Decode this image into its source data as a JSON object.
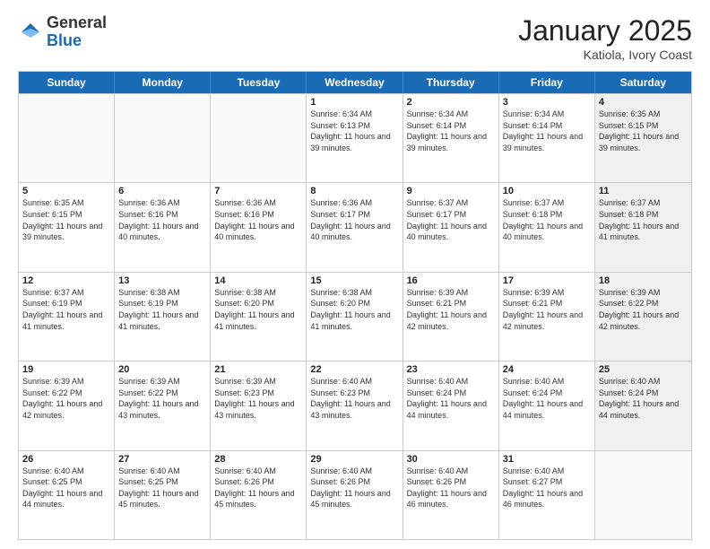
{
  "header": {
    "logo_general": "General",
    "logo_blue": "Blue",
    "month_title": "January 2025",
    "subtitle": "Katiola, Ivory Coast"
  },
  "days_of_week": [
    "Sunday",
    "Monday",
    "Tuesday",
    "Wednesday",
    "Thursday",
    "Friday",
    "Saturday"
  ],
  "weeks": [
    [
      {
        "day": "",
        "info": "",
        "empty": true
      },
      {
        "day": "",
        "info": "",
        "empty": true
      },
      {
        "day": "",
        "info": "",
        "empty": true
      },
      {
        "day": "1",
        "info": "Sunrise: 6:34 AM\nSunset: 6:13 PM\nDaylight: 11 hours and 39 minutes."
      },
      {
        "day": "2",
        "info": "Sunrise: 6:34 AM\nSunset: 6:14 PM\nDaylight: 11 hours and 39 minutes."
      },
      {
        "day": "3",
        "info": "Sunrise: 6:34 AM\nSunset: 6:14 PM\nDaylight: 11 hours and 39 minutes."
      },
      {
        "day": "4",
        "info": "Sunrise: 6:35 AM\nSunset: 6:15 PM\nDaylight: 11 hours and 39 minutes.",
        "shaded": true
      }
    ],
    [
      {
        "day": "5",
        "info": "Sunrise: 6:35 AM\nSunset: 6:15 PM\nDaylight: 11 hours and 39 minutes."
      },
      {
        "day": "6",
        "info": "Sunrise: 6:36 AM\nSunset: 6:16 PM\nDaylight: 11 hours and 40 minutes."
      },
      {
        "day": "7",
        "info": "Sunrise: 6:36 AM\nSunset: 6:16 PM\nDaylight: 11 hours and 40 minutes."
      },
      {
        "day": "8",
        "info": "Sunrise: 6:36 AM\nSunset: 6:17 PM\nDaylight: 11 hours and 40 minutes."
      },
      {
        "day": "9",
        "info": "Sunrise: 6:37 AM\nSunset: 6:17 PM\nDaylight: 11 hours and 40 minutes."
      },
      {
        "day": "10",
        "info": "Sunrise: 6:37 AM\nSunset: 6:18 PM\nDaylight: 11 hours and 40 minutes."
      },
      {
        "day": "11",
        "info": "Sunrise: 6:37 AM\nSunset: 6:18 PM\nDaylight: 11 hours and 41 minutes.",
        "shaded": true
      }
    ],
    [
      {
        "day": "12",
        "info": "Sunrise: 6:37 AM\nSunset: 6:19 PM\nDaylight: 11 hours and 41 minutes."
      },
      {
        "day": "13",
        "info": "Sunrise: 6:38 AM\nSunset: 6:19 PM\nDaylight: 11 hours and 41 minutes."
      },
      {
        "day": "14",
        "info": "Sunrise: 6:38 AM\nSunset: 6:20 PM\nDaylight: 11 hours and 41 minutes."
      },
      {
        "day": "15",
        "info": "Sunrise: 6:38 AM\nSunset: 6:20 PM\nDaylight: 11 hours and 41 minutes."
      },
      {
        "day": "16",
        "info": "Sunrise: 6:39 AM\nSunset: 6:21 PM\nDaylight: 11 hours and 42 minutes."
      },
      {
        "day": "17",
        "info": "Sunrise: 6:39 AM\nSunset: 6:21 PM\nDaylight: 11 hours and 42 minutes."
      },
      {
        "day": "18",
        "info": "Sunrise: 6:39 AM\nSunset: 6:22 PM\nDaylight: 11 hours and 42 minutes.",
        "shaded": true
      }
    ],
    [
      {
        "day": "19",
        "info": "Sunrise: 6:39 AM\nSunset: 6:22 PM\nDaylight: 11 hours and 42 minutes."
      },
      {
        "day": "20",
        "info": "Sunrise: 6:39 AM\nSunset: 6:22 PM\nDaylight: 11 hours and 43 minutes."
      },
      {
        "day": "21",
        "info": "Sunrise: 6:39 AM\nSunset: 6:23 PM\nDaylight: 11 hours and 43 minutes."
      },
      {
        "day": "22",
        "info": "Sunrise: 6:40 AM\nSunset: 6:23 PM\nDaylight: 11 hours and 43 minutes."
      },
      {
        "day": "23",
        "info": "Sunrise: 6:40 AM\nSunset: 6:24 PM\nDaylight: 11 hours and 44 minutes."
      },
      {
        "day": "24",
        "info": "Sunrise: 6:40 AM\nSunset: 6:24 PM\nDaylight: 11 hours and 44 minutes."
      },
      {
        "day": "25",
        "info": "Sunrise: 6:40 AM\nSunset: 6:24 PM\nDaylight: 11 hours and 44 minutes.",
        "shaded": true
      }
    ],
    [
      {
        "day": "26",
        "info": "Sunrise: 6:40 AM\nSunset: 6:25 PM\nDaylight: 11 hours and 44 minutes."
      },
      {
        "day": "27",
        "info": "Sunrise: 6:40 AM\nSunset: 6:25 PM\nDaylight: 11 hours and 45 minutes."
      },
      {
        "day": "28",
        "info": "Sunrise: 6:40 AM\nSunset: 6:26 PM\nDaylight: 11 hours and 45 minutes."
      },
      {
        "day": "29",
        "info": "Sunrise: 6:40 AM\nSunset: 6:26 PM\nDaylight: 11 hours and 45 minutes."
      },
      {
        "day": "30",
        "info": "Sunrise: 6:40 AM\nSunset: 6:26 PM\nDaylight: 11 hours and 46 minutes."
      },
      {
        "day": "31",
        "info": "Sunrise: 6:40 AM\nSunset: 6:27 PM\nDaylight: 11 hours and 46 minutes."
      },
      {
        "day": "",
        "info": "",
        "empty": true,
        "shaded": true
      }
    ]
  ]
}
